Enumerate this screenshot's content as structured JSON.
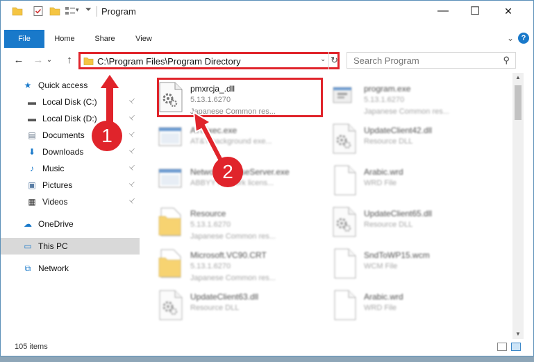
{
  "titlebar": {
    "title": "Program",
    "minimize": "—",
    "maximize": "☐",
    "close": "✕"
  },
  "ribbon": {
    "tabs": [
      "File",
      "Home",
      "Share",
      "View"
    ],
    "help": "?",
    "expand": "⌄"
  },
  "nav": {
    "back": "←",
    "forward": "→",
    "recent": "⌄",
    "up": "↑",
    "address": "C:\\Program Files\\Program Directory",
    "address_dropdown": "⌄",
    "refresh": "↻",
    "search_placeholder": "Search Program",
    "search_icon": "⚲"
  },
  "sidebar": {
    "items": [
      {
        "label": "Quick access",
        "icon": "star-icon",
        "glyph": "★",
        "color": "#1979ca"
      },
      {
        "label": "Local Disk (C:)",
        "icon": "drive-icon",
        "glyph": "▬",
        "color": "#555555"
      },
      {
        "label": "Local Disk (D:)",
        "icon": "drive-icon",
        "glyph": "▬",
        "color": "#555555"
      },
      {
        "label": "Documents",
        "icon": "documents-icon",
        "glyph": "▤",
        "color": "#6a7a8c"
      },
      {
        "label": "Downloads",
        "icon": "download-icon",
        "glyph": "⬇",
        "color": "#1979ca"
      },
      {
        "label": "Music",
        "icon": "music-icon",
        "glyph": "♪",
        "color": "#1979ca"
      },
      {
        "label": "Pictures",
        "icon": "pictures-icon",
        "glyph": "▣",
        "color": "#5a7ea5"
      },
      {
        "label": "Videos",
        "icon": "videos-icon",
        "glyph": "▦",
        "color": "#333333"
      },
      {
        "label": "OneDrive",
        "icon": "cloud-icon",
        "glyph": "☁",
        "color": "#1979ca"
      },
      {
        "label": "This PC",
        "icon": "computer-icon",
        "glyph": "▭",
        "color": "#1979ca"
      },
      {
        "label": "Network",
        "icon": "network-icon",
        "glyph": "⧉",
        "color": "#1979ca"
      }
    ],
    "pin_glyph": "📌"
  },
  "files": [
    {
      "name": "pmxrcja_.dll",
      "line2": "5.13.1.6270",
      "line3": "Japanese Common res...",
      "icon": "dll-icon"
    },
    {
      "name": "program.exe",
      "line2": "5.13.1.6270",
      "line3": "Japanese Common res...",
      "icon": "exe-icon"
    },
    {
      "name": "ATIExec.exe",
      "line2": "AT&T background exe...",
      "line3": "",
      "icon": "exe-window-icon"
    },
    {
      "name": "UpdateClient42.dll",
      "line2": "Resource DLL",
      "line3": "",
      "icon": "dll-icon"
    },
    {
      "name": "NetworkLicenseServer.exe",
      "line2": "ABBYY Network licens...",
      "line3": "",
      "icon": "exe-window-icon"
    },
    {
      "name": "Arabic.wrd",
      "line2": "WRD File",
      "line3": "",
      "icon": "blank-file-icon"
    },
    {
      "name": "Resource",
      "line2": "5.13.1.6270",
      "line3": "Japanese Common res...",
      "icon": "folder-file-icon"
    },
    {
      "name": "UpdateClient65.dll",
      "line2": "Resource DLL",
      "line3": "",
      "icon": "dll-icon"
    },
    {
      "name": "Microsoft.VC90.CRT",
      "line2": "5.13.1.6270",
      "line3": "Japanese Common res...",
      "icon": "folder-file-icon"
    },
    {
      "name": "SndToWP15.wcm",
      "line2": "WCM File",
      "line3": "",
      "icon": "blank-file-icon"
    },
    {
      "name": "UpdateClient63.dll",
      "line2": "Resource DLL",
      "line3": "",
      "icon": "dll-icon"
    },
    {
      "name": "Arabic.wrd",
      "line2": "WRD File",
      "line3": "",
      "icon": "blank-file-icon"
    }
  ],
  "status": {
    "count": "105 items"
  },
  "callouts": [
    "1",
    "2"
  ],
  "colors": {
    "accent": "#1979ca",
    "highlight": "#e0242b",
    "folder": "#f5c542"
  }
}
